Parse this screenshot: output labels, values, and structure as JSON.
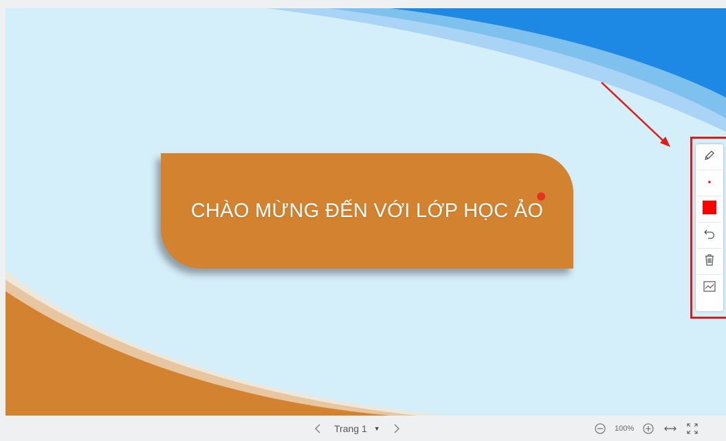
{
  "slide": {
    "title": "CHÀO MỪNG ĐẾN VỚI LỚP HỌC ẢO",
    "colors": {
      "background": "#d4eefa",
      "top_right_wave": "#1e88e5",
      "bottom_left_wave": "#d3832f",
      "title_box": "#d3832f"
    }
  },
  "annotation": {
    "highlight_color": "#e01b1b"
  },
  "toolbar": {
    "tools": [
      {
        "name": "pencil-icon"
      },
      {
        "name": "brush-size-dot-icon"
      },
      {
        "name": "color-swatch-icon",
        "color": "#ff0000"
      },
      {
        "name": "undo-icon"
      },
      {
        "name": "trash-icon"
      },
      {
        "name": "chart-icon"
      }
    ]
  },
  "bottom_bar": {
    "page_label": "Trang 1",
    "zoom_level": "100%"
  }
}
